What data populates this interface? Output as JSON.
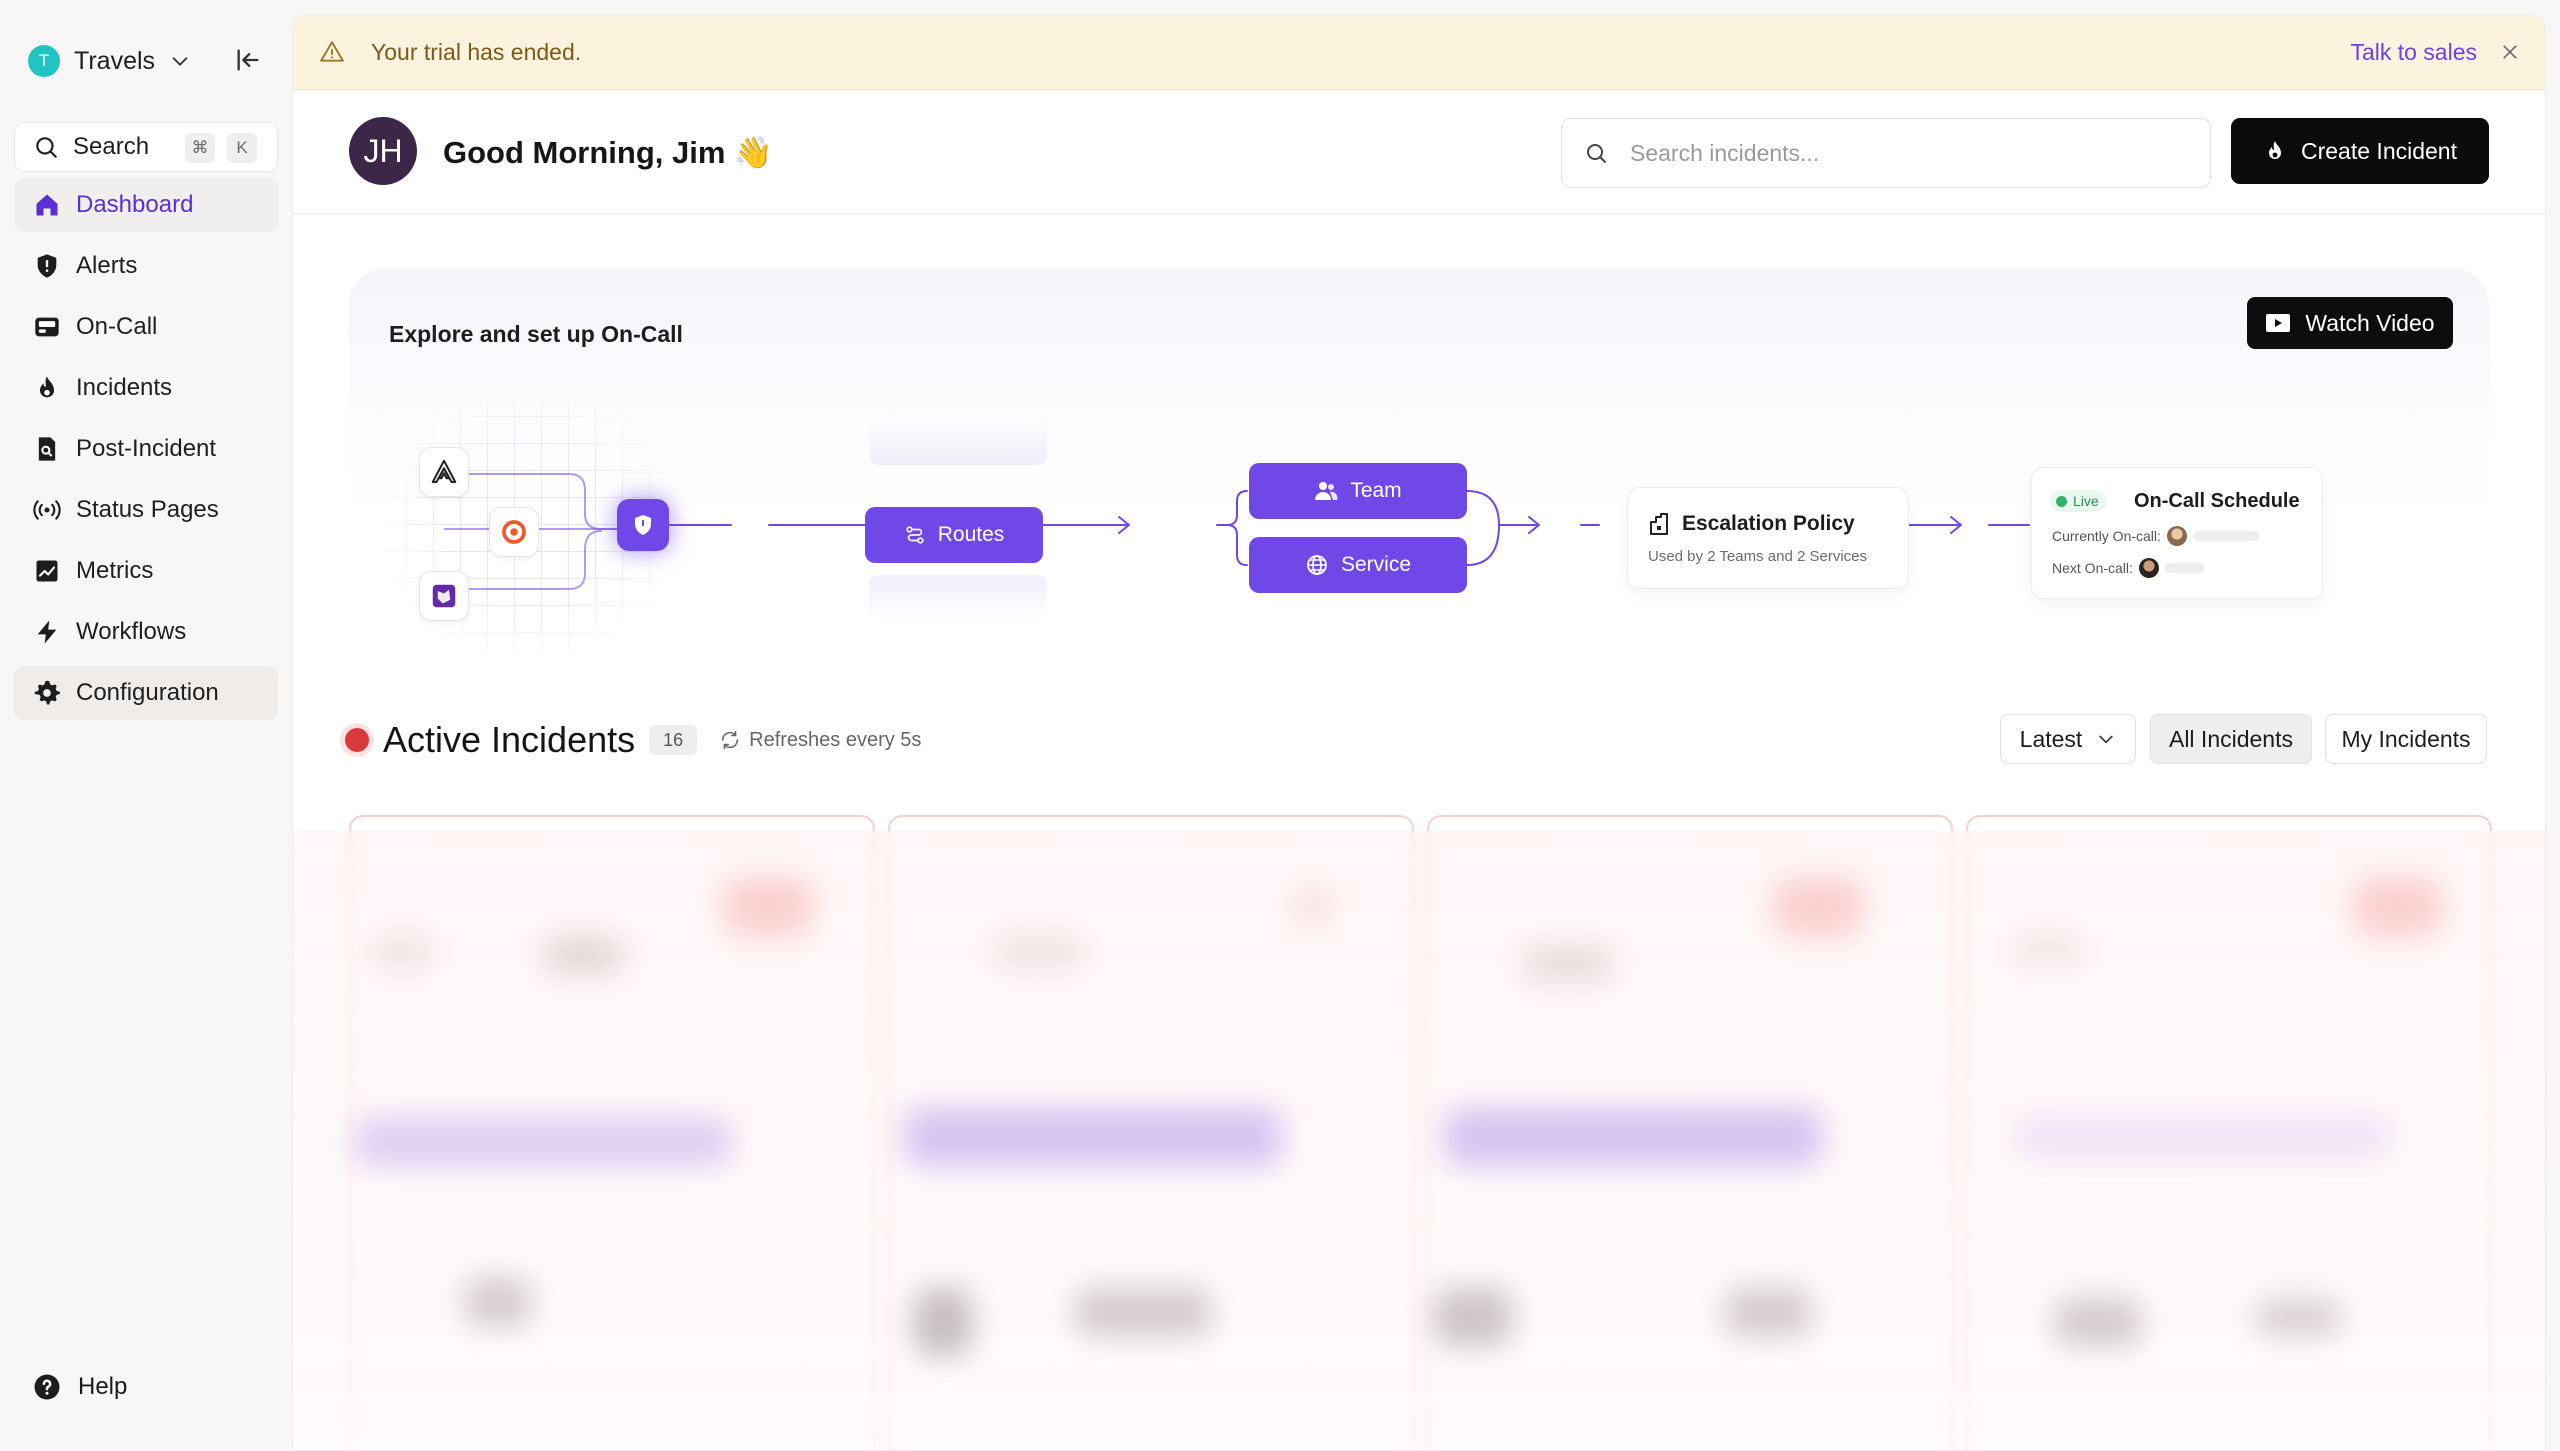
{
  "workspace": {
    "initial": "T",
    "name": "Travels"
  },
  "sidebar": {
    "search_label": "Search",
    "shortcut": [
      "⌘",
      "K"
    ],
    "items": [
      {
        "label": "Dashboard",
        "icon": "home-icon",
        "active": true
      },
      {
        "label": "Alerts",
        "icon": "shield-alert-icon"
      },
      {
        "label": "On-Call",
        "icon": "pager-icon"
      },
      {
        "label": "Incidents",
        "icon": "flame-icon"
      },
      {
        "label": "Post-Incident",
        "icon": "document-search-icon"
      },
      {
        "label": "Status Pages",
        "icon": "broadcast-icon"
      },
      {
        "label": "Metrics",
        "icon": "chart-icon"
      },
      {
        "label": "Workflows",
        "icon": "lightning-icon"
      },
      {
        "label": "Configuration",
        "icon": "gear-icon"
      }
    ],
    "help_label": "Help"
  },
  "banner": {
    "message": "Your trial has ended.",
    "cta": "Talk to sales"
  },
  "header": {
    "avatar_initials": "JH",
    "greeting": "Good Morning, Jim 👋",
    "search_placeholder": "Search incidents...",
    "create_label": "Create Incident"
  },
  "explore": {
    "title": "Explore and set up On-Call",
    "watch_label": "Watch Video",
    "routes_label": "Routes",
    "team_label": "Team",
    "service_label": "Service",
    "escalation": {
      "title": "Escalation Policy",
      "subtitle": "Used by 2 Teams and 2 Services"
    },
    "schedule": {
      "live": "Live",
      "title": "On-Call Schedule",
      "current": "Currently On-call:",
      "next": "Next On-call:"
    }
  },
  "incidents": {
    "title": "Active Incidents",
    "count": "16",
    "refresh": "Refreshes every 5s",
    "sort": "Latest",
    "filter_all": "All Incidents",
    "filter_mine": "My Incidents"
  },
  "colors": {
    "accent": "#7048e8",
    "active_text": "#5b2fd6",
    "banner_bg": "#fbf3dd",
    "danger": "#d83a3a"
  }
}
